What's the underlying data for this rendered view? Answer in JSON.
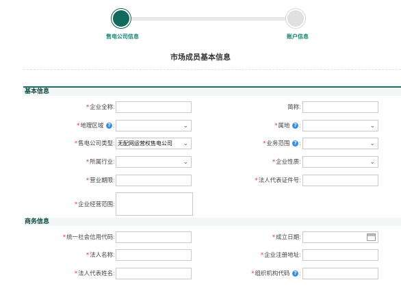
{
  "steps": [
    {
      "label": "售电公司信息",
      "active": true
    },
    {
      "label": "账户信息",
      "active": false
    }
  ],
  "page_title": "市场成员基本信息",
  "sections": {
    "basic": "基本信息",
    "business": "商务信息"
  },
  "colon": ":",
  "req": "*",
  "fields": {
    "full_name": {
      "label": "企业全称",
      "value": ""
    },
    "short_name": {
      "label": "简称",
      "value": ""
    },
    "region": {
      "label": "地理区域",
      "value": ""
    },
    "belong": {
      "label": "属地",
      "value": ""
    },
    "company_type": {
      "label": "售电公司类型",
      "value": "无配网运营权售电公司"
    },
    "biz_scope_sel": {
      "label": "业务范围",
      "value": ""
    },
    "industry": {
      "label": "所属行业",
      "value": ""
    },
    "nature": {
      "label": "企业性质",
      "value": ""
    },
    "term": {
      "label": "营业期限",
      "value": ""
    },
    "legal_id": {
      "label": "法人代表证件号",
      "value": ""
    },
    "op_scope": {
      "label": "企业经营范围",
      "value": ""
    },
    "credit_code": {
      "label": "统一社会信用代码",
      "value": ""
    },
    "est_date": {
      "label": "成立日期",
      "value": ""
    },
    "legal_name": {
      "label": "法人名称",
      "value": ""
    },
    "reg_addr": {
      "label": "企业注册地址",
      "value": ""
    },
    "rep_name": {
      "label": "法人代表姓名",
      "value": ""
    },
    "org_code": {
      "label": "组织机构代码",
      "value": ""
    }
  },
  "icons": {
    "help": "help-icon",
    "chevron": "chevron-down-icon",
    "calendar": "calendar-icon"
  },
  "colors": {
    "accent": "#126a5c",
    "required": "#d33"
  }
}
